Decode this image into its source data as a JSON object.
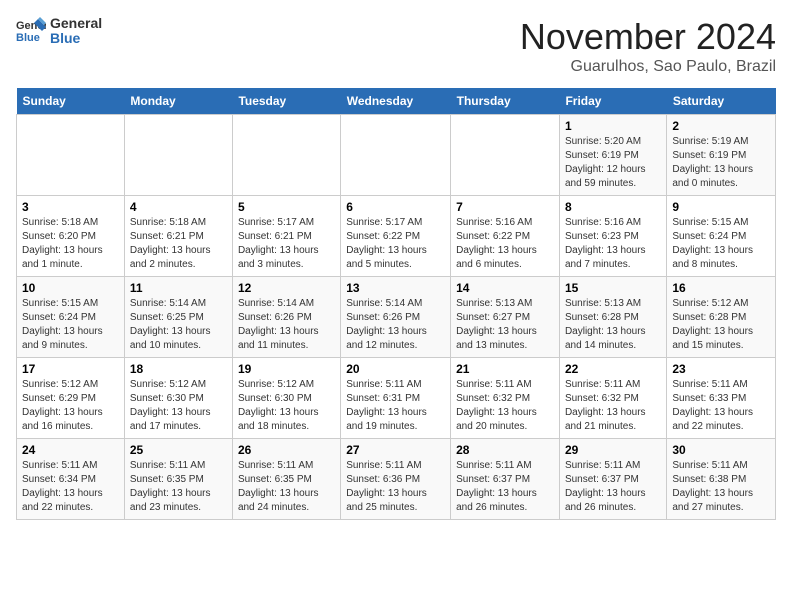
{
  "logo": {
    "line1": "General",
    "line2": "Blue"
  },
  "title": "November 2024",
  "subtitle": "Guarulhos, Sao Paulo, Brazil",
  "weekdays": [
    "Sunday",
    "Monday",
    "Tuesday",
    "Wednesday",
    "Thursday",
    "Friday",
    "Saturday"
  ],
  "weeks": [
    [
      {
        "day": "",
        "info": ""
      },
      {
        "day": "",
        "info": ""
      },
      {
        "day": "",
        "info": ""
      },
      {
        "day": "",
        "info": ""
      },
      {
        "day": "",
        "info": ""
      },
      {
        "day": "1",
        "info": "Sunrise: 5:20 AM\nSunset: 6:19 PM\nDaylight: 12 hours\nand 59 minutes."
      },
      {
        "day": "2",
        "info": "Sunrise: 5:19 AM\nSunset: 6:19 PM\nDaylight: 13 hours\nand 0 minutes."
      }
    ],
    [
      {
        "day": "3",
        "info": "Sunrise: 5:18 AM\nSunset: 6:20 PM\nDaylight: 13 hours\nand 1 minute."
      },
      {
        "day": "4",
        "info": "Sunrise: 5:18 AM\nSunset: 6:21 PM\nDaylight: 13 hours\nand 2 minutes."
      },
      {
        "day": "5",
        "info": "Sunrise: 5:17 AM\nSunset: 6:21 PM\nDaylight: 13 hours\nand 3 minutes."
      },
      {
        "day": "6",
        "info": "Sunrise: 5:17 AM\nSunset: 6:22 PM\nDaylight: 13 hours\nand 5 minutes."
      },
      {
        "day": "7",
        "info": "Sunrise: 5:16 AM\nSunset: 6:22 PM\nDaylight: 13 hours\nand 6 minutes."
      },
      {
        "day": "8",
        "info": "Sunrise: 5:16 AM\nSunset: 6:23 PM\nDaylight: 13 hours\nand 7 minutes."
      },
      {
        "day": "9",
        "info": "Sunrise: 5:15 AM\nSunset: 6:24 PM\nDaylight: 13 hours\nand 8 minutes."
      }
    ],
    [
      {
        "day": "10",
        "info": "Sunrise: 5:15 AM\nSunset: 6:24 PM\nDaylight: 13 hours\nand 9 minutes."
      },
      {
        "day": "11",
        "info": "Sunrise: 5:14 AM\nSunset: 6:25 PM\nDaylight: 13 hours\nand 10 minutes."
      },
      {
        "day": "12",
        "info": "Sunrise: 5:14 AM\nSunset: 6:26 PM\nDaylight: 13 hours\nand 11 minutes."
      },
      {
        "day": "13",
        "info": "Sunrise: 5:14 AM\nSunset: 6:26 PM\nDaylight: 13 hours\nand 12 minutes."
      },
      {
        "day": "14",
        "info": "Sunrise: 5:13 AM\nSunset: 6:27 PM\nDaylight: 13 hours\nand 13 minutes."
      },
      {
        "day": "15",
        "info": "Sunrise: 5:13 AM\nSunset: 6:28 PM\nDaylight: 13 hours\nand 14 minutes."
      },
      {
        "day": "16",
        "info": "Sunrise: 5:12 AM\nSunset: 6:28 PM\nDaylight: 13 hours\nand 15 minutes."
      }
    ],
    [
      {
        "day": "17",
        "info": "Sunrise: 5:12 AM\nSunset: 6:29 PM\nDaylight: 13 hours\nand 16 minutes."
      },
      {
        "day": "18",
        "info": "Sunrise: 5:12 AM\nSunset: 6:30 PM\nDaylight: 13 hours\nand 17 minutes."
      },
      {
        "day": "19",
        "info": "Sunrise: 5:12 AM\nSunset: 6:30 PM\nDaylight: 13 hours\nand 18 minutes."
      },
      {
        "day": "20",
        "info": "Sunrise: 5:11 AM\nSunset: 6:31 PM\nDaylight: 13 hours\nand 19 minutes."
      },
      {
        "day": "21",
        "info": "Sunrise: 5:11 AM\nSunset: 6:32 PM\nDaylight: 13 hours\nand 20 minutes."
      },
      {
        "day": "22",
        "info": "Sunrise: 5:11 AM\nSunset: 6:32 PM\nDaylight: 13 hours\nand 21 minutes."
      },
      {
        "day": "23",
        "info": "Sunrise: 5:11 AM\nSunset: 6:33 PM\nDaylight: 13 hours\nand 22 minutes."
      }
    ],
    [
      {
        "day": "24",
        "info": "Sunrise: 5:11 AM\nSunset: 6:34 PM\nDaylight: 13 hours\nand 22 minutes."
      },
      {
        "day": "25",
        "info": "Sunrise: 5:11 AM\nSunset: 6:35 PM\nDaylight: 13 hours\nand 23 minutes."
      },
      {
        "day": "26",
        "info": "Sunrise: 5:11 AM\nSunset: 6:35 PM\nDaylight: 13 hours\nand 24 minutes."
      },
      {
        "day": "27",
        "info": "Sunrise: 5:11 AM\nSunset: 6:36 PM\nDaylight: 13 hours\nand 25 minutes."
      },
      {
        "day": "28",
        "info": "Sunrise: 5:11 AM\nSunset: 6:37 PM\nDaylight: 13 hours\nand 26 minutes."
      },
      {
        "day": "29",
        "info": "Sunrise: 5:11 AM\nSunset: 6:37 PM\nDaylight: 13 hours\nand 26 minutes."
      },
      {
        "day": "30",
        "info": "Sunrise: 5:11 AM\nSunset: 6:38 PM\nDaylight: 13 hours\nand 27 minutes."
      }
    ]
  ]
}
